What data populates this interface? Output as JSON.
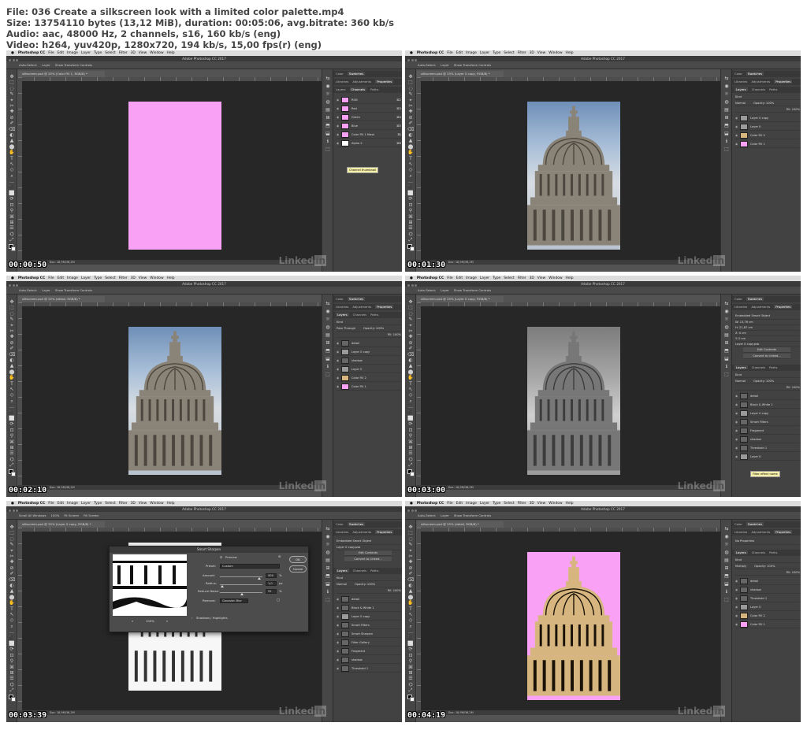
{
  "header": {
    "line1": "File: 036 Create a silkscreen look with a limited color palette.mp4",
    "line2": "Size: 13754110 bytes (13,12 MiB), duration: 00:05:06, avg.bitrate: 360 kb/s",
    "line3": "Audio: aac, 48000 Hz, 2 channels, s16, 160 kb/s (eng)",
    "line4": "Video: h264, yuv420p, 1280x720, 194 kb/s, 15,00 fps(r) (eng)"
  },
  "app": {
    "menu": [
      "Photoshop CC",
      "File",
      "Edit",
      "Image",
      "Layer",
      "Type",
      "Select",
      "Filter",
      "3D",
      "View",
      "Window",
      "Help"
    ],
    "window_title": "Adobe Photoshop CC 2017",
    "watermark": "Linked",
    "watermark_in": "in",
    "status_zoom": "25%",
    "status_doc": "Doc: 18,9M/36,2M"
  },
  "colors": {
    "pink": "#f9a2f5",
    "tan": "#d6b67e",
    "ui_dark": "#535353"
  },
  "frames": [
    {
      "timestamp": "00:00:50",
      "doc_tab": "silkscreen.psd @ 25% (Color Fill 1, RGB/8) *",
      "options": [
        "Auto-Select:",
        "Layer",
        "Show Transform Controls"
      ],
      "panel_top_tabs": [
        "Color",
        "Swatches"
      ],
      "panel_mid_tabs": [
        "Libraries",
        "Adjustments",
        "Properties"
      ],
      "panel_tabs": [
        "Layers",
        "Channels",
        "Paths"
      ],
      "rows": [
        {
          "label": "RGB",
          "key": "⌘2"
        },
        {
          "label": "Red",
          "key": "⌘3"
        },
        {
          "label": "Green",
          "key": "⌘4"
        },
        {
          "label": "Blue",
          "key": "⌘5"
        },
        {
          "label": "Color Fill 1 Mask",
          "key": "⌘\\"
        },
        {
          "label": "Alpha 2",
          "key": "⌘6"
        }
      ],
      "tooltip": "Channel thumbnail"
    },
    {
      "timestamp": "00:01:30",
      "doc_tab": "silkscreen.psd @ 25% (Layer 0 copy, RGB/8) *",
      "options": [
        "Auto-Select:",
        "Layer",
        "Show Transform Controls"
      ],
      "panel_top_tabs": [
        "Color",
        "Swatches"
      ],
      "panel_mid_tabs": [
        "Libraries",
        "Adjustments",
        "Properties"
      ],
      "panel_tabs": [
        "Layers",
        "Channels",
        "Paths"
      ],
      "layer_kind": "Kind",
      "blend_mode": "Normal",
      "opacity": "Opacity: 100%",
      "fill": "Fill: 100%",
      "rows": [
        {
          "label": "Layer 0 copy"
        },
        {
          "label": "Layer 0"
        },
        {
          "label": "Color Fill 2"
        },
        {
          "label": "Color Fill 1"
        }
      ]
    },
    {
      "timestamp": "00:02:10",
      "doc_tab": "silkscreen.psd @ 25% (detail, RGB/8) *",
      "options": [
        "Auto-Select:",
        "Layer",
        "Show Transform Controls"
      ],
      "panel_top_tabs": [
        "Color",
        "Swatches"
      ],
      "panel_mid_tabs": [
        "Libraries",
        "Adjustments",
        "Properties"
      ],
      "panel_tabs": [
        "Layers",
        "Channels",
        "Paths"
      ],
      "layer_kind": "Kind",
      "blend_mode": "Pass Through",
      "opacity": "Opacity: 100%",
      "fill": "Fill: 100%",
      "rows": [
        {
          "label": "detail"
        },
        {
          "label": "Layer 0 copy"
        },
        {
          "label": "shadow"
        },
        {
          "label": "Layer 0"
        },
        {
          "label": "Color Fill 2"
        },
        {
          "label": "Color Fill 1"
        }
      ]
    },
    {
      "timestamp": "00:03:00",
      "doc_tab": "silkscreen.psd @ 25% (Layer 0 copy, RGB/8) *",
      "options": [
        "Auto-Select:",
        "Layer",
        "Show Transform Controls"
      ],
      "panel_top_tabs": [
        "Color",
        "Swatches"
      ],
      "panel_mid_tabs": [
        "Libraries",
        "Adjustments",
        "Properties"
      ],
      "props_title": "Embedded Smart Object",
      "props_w": "W: 13,76 cm",
      "props_h": "H: 21,87 cm",
      "props_x": "X: 0 cm",
      "props_y": "Y: 0 cm",
      "props_file": "Layer 0 copy.psb",
      "props_btn1": "Edit Contents",
      "props_btn2": "Convert to Linked...",
      "panel_tabs": [
        "Layers",
        "Channels",
        "Paths"
      ],
      "layer_kind": "Kind",
      "blend_mode": "Normal",
      "opacity": "Opacity: 100%",
      "fill": "Fill: 100%",
      "rows": [
        {
          "label": "detail"
        },
        {
          "label": "Black & White 1"
        },
        {
          "label": "Layer 0 copy"
        },
        {
          "label": "Smart Filters"
        },
        {
          "label": "Fragment"
        },
        {
          "label": "shadow"
        },
        {
          "label": "Threshold 1"
        },
        {
          "label": "Layer 0"
        }
      ],
      "tooltip": "Filter effect name"
    },
    {
      "timestamp": "00:03:39",
      "doc_tab": "silkscreen.psd @ 25% (Layer 0 copy, RGB/8) *",
      "options": [
        "Scroll All Windows",
        "100%",
        "Fit Screen",
        "Fill Screen"
      ],
      "panel_top_tabs": [
        "Color",
        "Swatches"
      ],
      "panel_mid_tabs": [
        "Libraries",
        "Adjustments",
        "Properties"
      ],
      "props_title": "Embedded Smart Object",
      "props_file": "Layer 0 copy.psb",
      "props_btn1": "Edit Contents",
      "props_btn2": "Convert to Linked...",
      "panel_tabs": [
        "Layers",
        "Channels",
        "Paths"
      ],
      "layer_kind": "Kind",
      "blend_mode": "Normal",
      "opacity": "Opacity: 100%",
      "fill": "Fill: 100%",
      "rows": [
        {
          "label": "detail"
        },
        {
          "label": "Black & White 1"
        },
        {
          "label": "Layer 0 copy"
        },
        {
          "label": "Smart Filters"
        },
        {
          "label": "Smart Sharpen"
        },
        {
          "label": "Filter Gallery"
        },
        {
          "label": "Fragment"
        },
        {
          "label": "shadow"
        },
        {
          "label": "Threshold 1"
        }
      ],
      "dialog": {
        "title": "Smart Sharpen",
        "preview": "Preview",
        "preset_label": "Preset:",
        "preset_value": "Custom",
        "amount_label": "Amount:",
        "amount_value": "500",
        "amount_unit": "%",
        "radius_label": "Radius:",
        "radius_value": "1,0",
        "radius_unit": "px",
        "noise_label": "Reduce Noise:",
        "noise_value": "52",
        "noise_unit": "%",
        "remove_label": "Remove:",
        "remove_value": "Gaussian Blur",
        "shadows": "Shadows / Highlights",
        "ok": "OK",
        "cancel": "Cancel",
        "zoom": "100%"
      }
    },
    {
      "timestamp": "00:04:19",
      "doc_tab": "silkscreen.psd @ 25% (detail, RGB/8) *",
      "options": [
        "Auto-Select:",
        "Layer",
        "Show Transform Controls"
      ],
      "panel_top_tabs": [
        "Color",
        "Swatches"
      ],
      "panel_mid_tabs": [
        "Libraries",
        "Adjustments",
        "Properties"
      ],
      "props_title": "No Properties",
      "panel_tabs": [
        "Layers",
        "Channels",
        "Paths"
      ],
      "layer_kind": "Kind",
      "blend_mode": "Multiply",
      "opacity": "Opacity: 100%",
      "fill": "Fill: 100%",
      "rows": [
        {
          "label": "detail"
        },
        {
          "label": "shadow"
        },
        {
          "label": "Threshold 1"
        },
        {
          "label": "Layer 0"
        },
        {
          "label": "Color Fill 2"
        },
        {
          "label": "Color Fill 1"
        }
      ]
    }
  ]
}
